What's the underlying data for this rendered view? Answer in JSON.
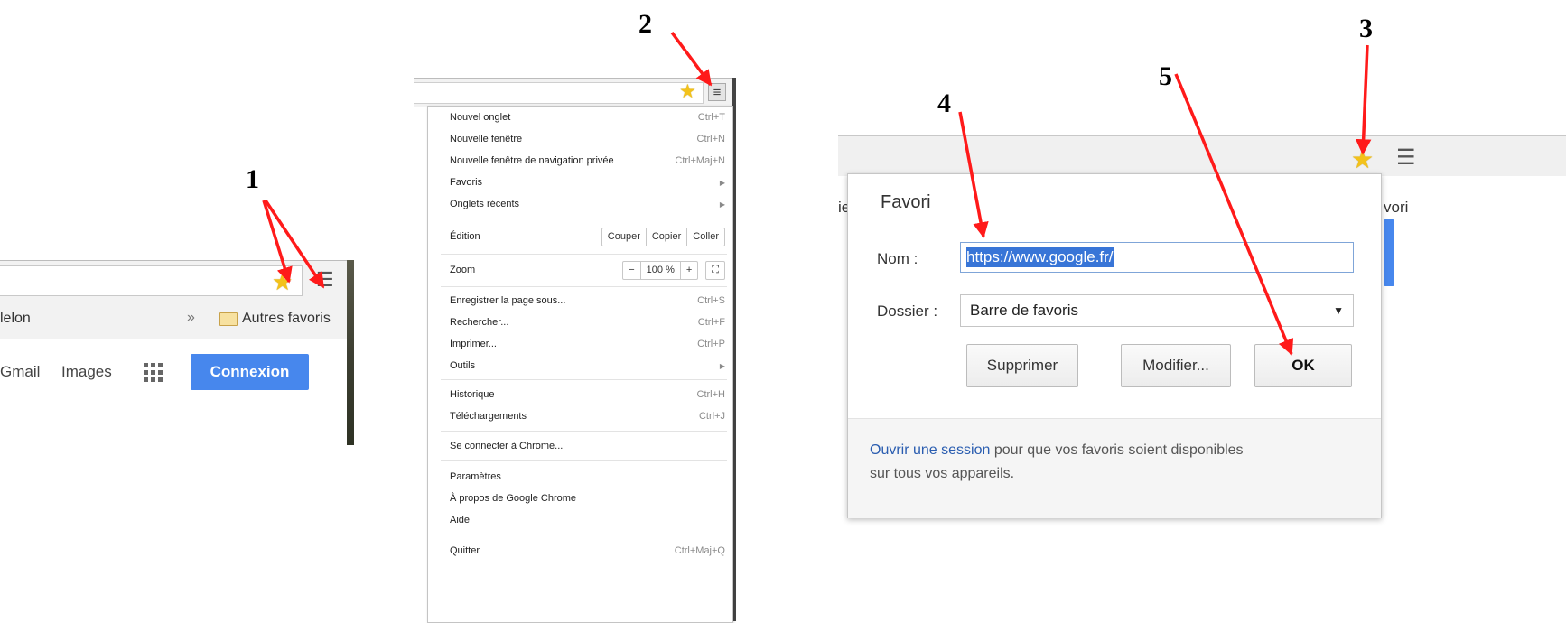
{
  "colors": {
    "annotation_red": "#ff1a1a",
    "accent_blue": "#4787ed",
    "selection_blue": "#3875d7",
    "star_yellow": "#f3c21a"
  },
  "icons": [
    "star-icon",
    "menu-icon",
    "folder-icon",
    "apps-grid-icon",
    "dropdown-arrow-icon",
    "submenu-arrow-icon",
    "fullscreen-icon"
  ],
  "annotations": {
    "n1": "1",
    "n2": "2",
    "n3": "3",
    "n4": "4",
    "n5": "5"
  },
  "panel1": {
    "bookmark_left": "lelon",
    "chevron": "»",
    "other_bookmarks": "Autres favoris",
    "gmail": "Gmail",
    "images": "Images",
    "signin": "Connexion"
  },
  "panel2": {
    "menu": {
      "new_tab": {
        "label": "Nouvel onglet",
        "shortcut": "Ctrl+T"
      },
      "new_window": {
        "label": "Nouvelle fenêtre",
        "shortcut": "Ctrl+N"
      },
      "incognito": {
        "label": "Nouvelle fenêtre de navigation privée",
        "shortcut": "Ctrl+Maj+N"
      },
      "bookmarks": {
        "label": "Favoris"
      },
      "recent_tabs": {
        "label": "Onglets récents"
      },
      "edit": {
        "label": "Édition",
        "cut": "Couper",
        "copy": "Copier",
        "paste": "Coller"
      },
      "zoom": {
        "label": "Zoom",
        "minus": "−",
        "value": "100 %",
        "plus": "+"
      },
      "save_page": {
        "label": "Enregistrer la page sous...",
        "shortcut": "Ctrl+S"
      },
      "find": {
        "label": "Rechercher...",
        "shortcut": "Ctrl+F"
      },
      "print": {
        "label": "Imprimer...",
        "shortcut": "Ctrl+P"
      },
      "tools": {
        "label": "Outils"
      },
      "history": {
        "label": "Historique",
        "shortcut": "Ctrl+H"
      },
      "downloads": {
        "label": "Téléchargements",
        "shortcut": "Ctrl+J"
      },
      "signin": {
        "label": "Se connecter à Chrome..."
      },
      "settings": {
        "label": "Paramètres"
      },
      "about": {
        "label": "À propos de Google Chrome"
      },
      "help": {
        "label": "Aide"
      },
      "quit": {
        "label": "Quitter",
        "shortcut": "Ctrl+Maj+Q"
      }
    }
  },
  "panel3": {
    "partial_left": "ie",
    "partial_right": "vori",
    "dialog": {
      "title": "Favori",
      "name_label": "Nom :",
      "name_value": "https://www.google.fr/",
      "folder_label": "Dossier :",
      "folder_value": "Barre de favoris",
      "remove_btn": "Supprimer",
      "edit_btn": "Modifier...",
      "ok_btn": "OK",
      "footer_link": "Ouvrir une session",
      "footer_line1": " pour que vos favoris soient disponibles",
      "footer_line2": "sur tous vos appareils."
    }
  }
}
